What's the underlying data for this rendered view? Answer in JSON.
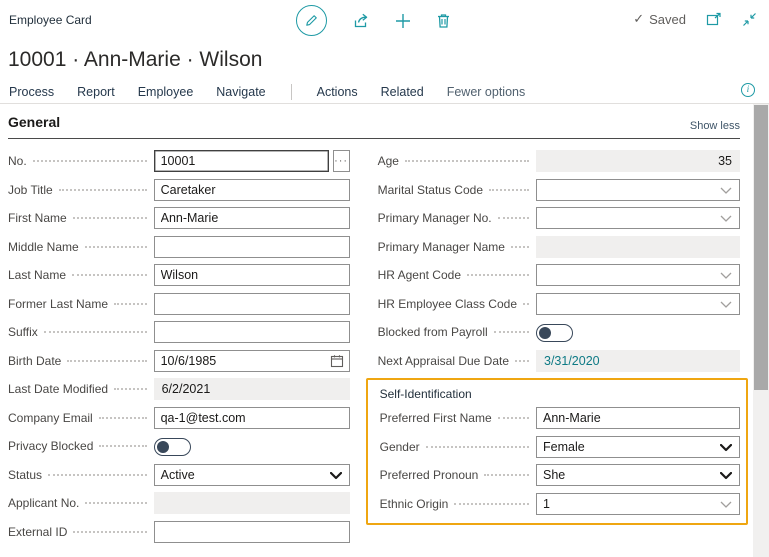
{
  "colors": {
    "accent_teal": "#1e9aa5",
    "highlight_amber": "#efa611",
    "link_teal": "#0e7a85",
    "disabled_bg": "#f0efee"
  },
  "header": {
    "app_caption": "Employee Card",
    "page_title": "10001 · Ann-Marie · Wilson",
    "saved_check": "✓",
    "saved_label": "Saved"
  },
  "ribbon": {
    "menus": [
      "Process",
      "Report",
      "Employee",
      "Navigate"
    ],
    "menus_secondary": [
      "Actions",
      "Related"
    ],
    "fewer_options": "Fewer options",
    "info_glyph": "i"
  },
  "general": {
    "section_title": "General",
    "show_less": "Show less"
  },
  "left": {
    "no": {
      "label": "No.",
      "value": "10001",
      "assist_glyph": "···"
    },
    "job_title": {
      "label": "Job Title",
      "value": "Caretaker"
    },
    "first_name": {
      "label": "First Name",
      "value": "Ann-Marie"
    },
    "middle_name": {
      "label": "Middle Name",
      "value": ""
    },
    "last_name": {
      "label": "Last Name",
      "value": "Wilson"
    },
    "former_last_name": {
      "label": "Former Last Name",
      "value": ""
    },
    "suffix": {
      "label": "Suffix",
      "value": ""
    },
    "birth_date": {
      "label": "Birth Date",
      "value": "10/6/1985"
    },
    "last_date_modified": {
      "label": "Last Date Modified",
      "value": "6/2/2021"
    },
    "company_email": {
      "label": "Company Email",
      "value": "qa-1@test.com"
    },
    "privacy_blocked": {
      "label": "Privacy Blocked",
      "state": "off"
    },
    "status": {
      "label": "Status",
      "value": "Active"
    },
    "applicant_no": {
      "label": "Applicant No.",
      "value": ""
    },
    "external_id": {
      "label": "External ID",
      "value": ""
    }
  },
  "right": {
    "age": {
      "label": "Age",
      "value": "35"
    },
    "marital_status_code": {
      "label": "Marital Status Code",
      "value": ""
    },
    "primary_manager_no": {
      "label": "Primary Manager No.",
      "value": ""
    },
    "primary_manager_name": {
      "label": "Primary Manager Name",
      "value": ""
    },
    "hr_agent_code": {
      "label": "HR Agent Code",
      "value": ""
    },
    "hr_employee_class_code": {
      "label": "HR Employee Class Code",
      "value": ""
    },
    "blocked_from_payroll": {
      "label": "Blocked from Payroll",
      "state": "off"
    },
    "next_appraisal_due_date": {
      "label": "Next Appraisal Due Date",
      "value": "3/31/2020"
    }
  },
  "self_identification": {
    "group_title": "Self-Identification",
    "preferred_first_name": {
      "label": "Preferred First Name",
      "value": "Ann-Marie"
    },
    "gender": {
      "label": "Gender",
      "value": "Female"
    },
    "preferred_pronoun": {
      "label": "Preferred Pronoun",
      "value": "She"
    },
    "ethnic_origin": {
      "label": "Ethnic Origin",
      "value": "1"
    }
  }
}
